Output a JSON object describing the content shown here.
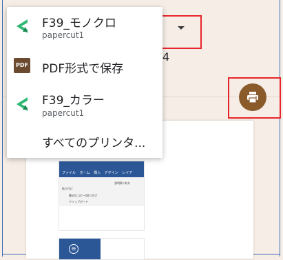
{
  "printer_menu": {
    "items": [
      {
        "title": "F39_モノクロ",
        "subtitle": "papercut1",
        "icon": "printer-arrow-icon"
      },
      {
        "title": "PDF形式で保存",
        "subtitle": "",
        "icon": "pdf-icon"
      },
      {
        "title": "F39_カラー",
        "subtitle": "papercut1",
        "icon": "printer-arrow-icon"
      },
      {
        "title": "すべてのプリンタ...",
        "subtitle": "",
        "icon": ""
      }
    ],
    "pdf_badge": "PDF"
  },
  "partial_text": "4",
  "print_button": {
    "icon": "print-icon"
  },
  "preview": {
    "ribbon_tabs": [
      "ファイル",
      "ホーム",
      "挿入",
      "デザイン",
      "レイア"
    ],
    "toolbar_items": [
      "貼り付け",
      "書式のコピー/貼り付け",
      "クリップボード",
      "游明朝 (本文"
    ],
    "thumb2_symbol": "⊖"
  },
  "colors": {
    "accent": "#8a5a2b",
    "highlight_box": "#e8242b",
    "word_blue": "#2b5797",
    "arrow_green": "#2eb872"
  }
}
